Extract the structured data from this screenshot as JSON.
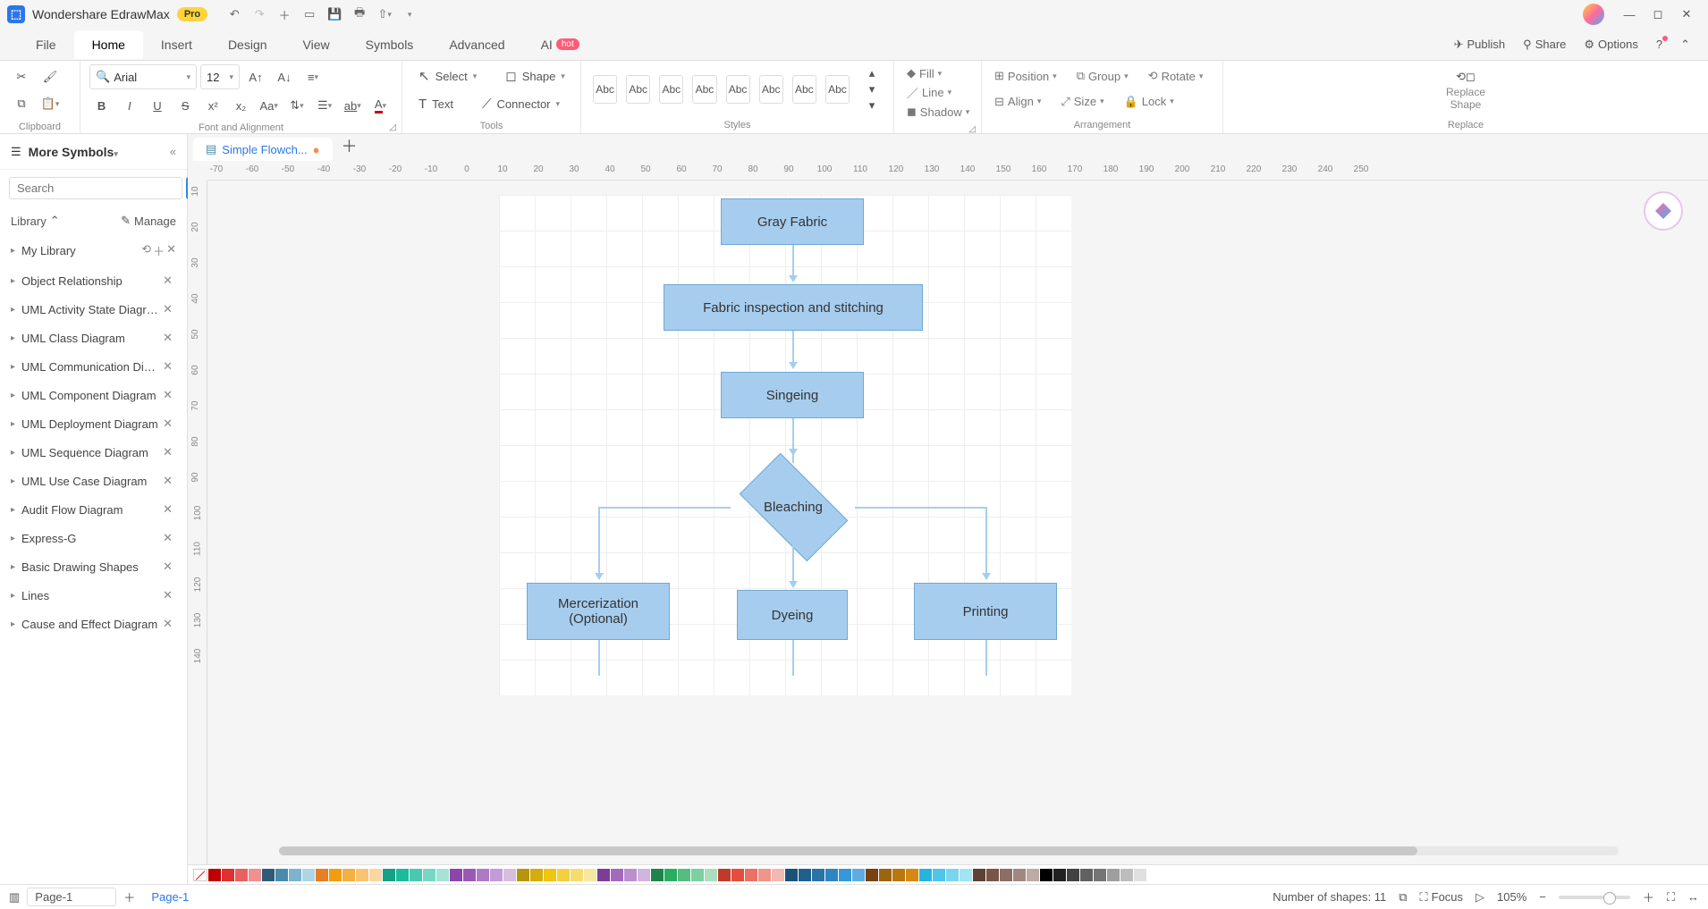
{
  "app": {
    "name": "Wondershare EdrawMax",
    "badge": "Pro"
  },
  "menubar": {
    "tabs": [
      "File",
      "Home",
      "Insert",
      "Design",
      "View",
      "Symbols",
      "Advanced",
      "AI"
    ],
    "active": "Home",
    "hot_badge": "hot",
    "publish": "Publish",
    "share": "Share",
    "options": "Options"
  },
  "ribbon": {
    "font_name": "Arial",
    "font_size": "12",
    "select": "Select",
    "shape": "Shape",
    "text": "Text",
    "connector": "Connector",
    "style_label": "Abc",
    "fill": "Fill",
    "line": "Line",
    "shadow": "Shadow",
    "position": "Position",
    "group": "Group",
    "rotate": "Rotate",
    "align": "Align",
    "size": "Size",
    "lock": "Lock",
    "replace_shape_l1": "Replace",
    "replace_shape_l2": "Shape",
    "groups": {
      "clipboard": "Clipboard",
      "font": "Font and Alignment",
      "tools": "Tools",
      "styles": "Styles",
      "arrangement": "Arrangement",
      "replace": "Replace"
    }
  },
  "left_panel": {
    "title": "More Symbols",
    "search_placeholder": "Search",
    "search_btn": "Search",
    "library": "Library",
    "manage": "Manage",
    "items": [
      "My Library",
      "Object Relationship",
      "UML Activity State Diagram",
      "UML Class Diagram",
      "UML Communication Diag...",
      "UML Component Diagram",
      "UML Deployment Diagram",
      "UML Sequence Diagram",
      "UML Use Case Diagram",
      "Audit Flow Diagram",
      "Express-G",
      "Basic Drawing Shapes",
      "Lines",
      "Cause and Effect Diagram"
    ]
  },
  "doc": {
    "tab_name": "Simple Flowch...",
    "page_tab": "Page-1"
  },
  "ruler_h": [
    "-70",
    "-60",
    "-50",
    "-40",
    "-30",
    "-20",
    "-10",
    "0",
    "10",
    "20",
    "30",
    "40",
    "50",
    "60",
    "70",
    "80",
    "90",
    "100",
    "110",
    "120",
    "130",
    "140",
    "150",
    "160",
    "170",
    "180",
    "190",
    "200",
    "210",
    "220",
    "230",
    "240",
    "250"
  ],
  "ruler_v": [
    "10",
    "20",
    "30",
    "40",
    "50",
    "60",
    "70",
    "80",
    "90",
    "100",
    "110",
    "120",
    "130",
    "140"
  ],
  "flowchart": {
    "n1": "Gray Fabric",
    "n2": "Fabric inspection and stitching",
    "n3": "Singeing",
    "n4": "Bleaching",
    "n5_l1": "Mercerization",
    "n5_l2": "(Optional)",
    "n6": "Dyeing",
    "n7": "Printing"
  },
  "status": {
    "page_selector": "Page-1",
    "shape_count": "Number of shapes: 11",
    "focus": "Focus",
    "zoom": "105%"
  },
  "swatches": [
    "#c00000",
    "#e03030",
    "#e86060",
    "#f09090",
    "#2f5b7a",
    "#4a8bad",
    "#7cb3cf",
    "#aed5e6",
    "#e67e22",
    "#f39c12",
    "#f5b041",
    "#f8c471",
    "#fad7a0",
    "#16a085",
    "#1abc9c",
    "#48c9b0",
    "#76d7c4",
    "#a3e4d7",
    "#8e44ad",
    "#9b59b6",
    "#af7ac5",
    "#c39bd9",
    "#d7bde2",
    "#b7950b",
    "#d4ac0d",
    "#f1c40f",
    "#f4d03f",
    "#f7dc6f",
    "#f9e79f",
    "#7d3c98",
    "#a569bd",
    "#bb8fce",
    "#d2b4de",
    "#1e8449",
    "#27ae60",
    "#52be80",
    "#7dcea0",
    "#a9dfbf",
    "#c0392b",
    "#e74c3c",
    "#ec7063",
    "#f1948a",
    "#f5b7b1",
    "#1a5276",
    "#1f618d",
    "#2874a6",
    "#2e86c1",
    "#3498db",
    "#5dade2",
    "#784212",
    "#9c640c",
    "#b9770e",
    "#d68910",
    "#26b4e0",
    "#4fc5e8",
    "#78d5ef",
    "#a1e4f6",
    "#5d4037",
    "#795548",
    "#8d6e63",
    "#a1887f",
    "#bcaaa4",
    "#000000",
    "#212121",
    "#424242",
    "#616161",
    "#757575",
    "#9e9e9e",
    "#bdbdbd",
    "#e0e0e0",
    "#ffffff"
  ]
}
